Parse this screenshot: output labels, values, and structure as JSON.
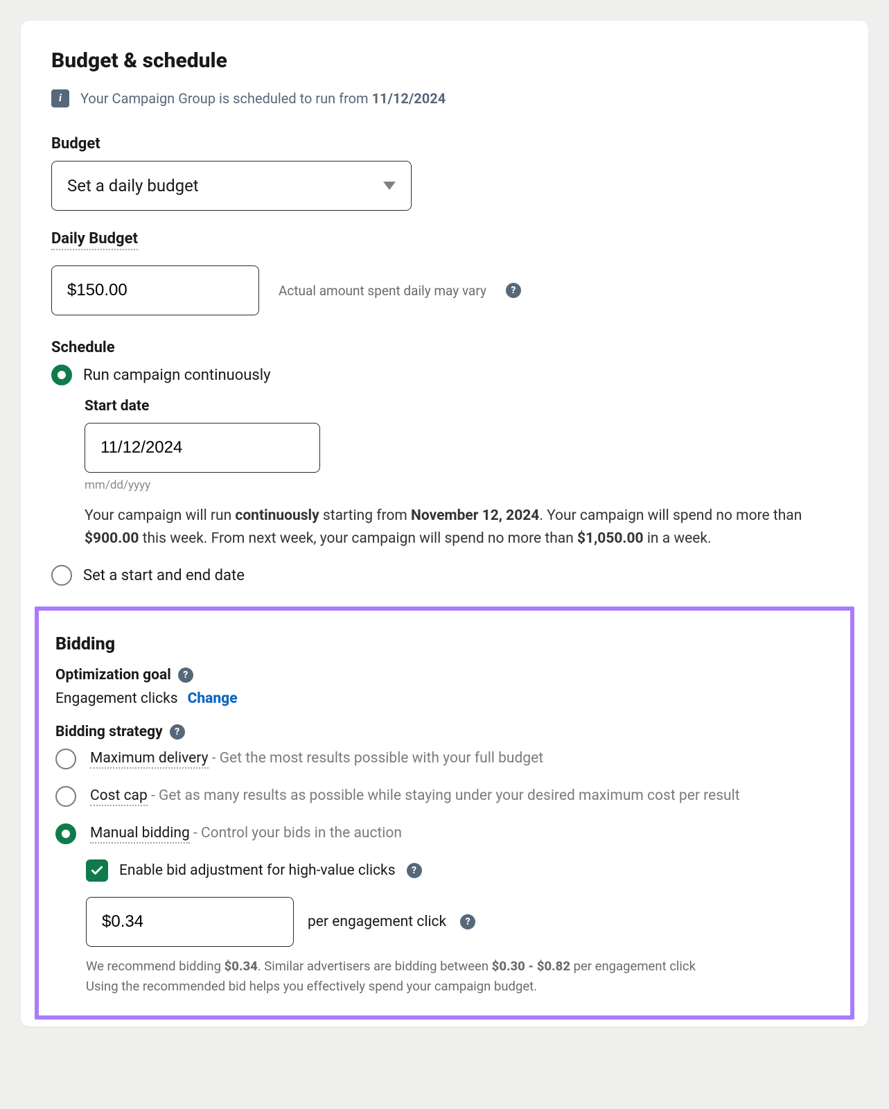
{
  "header": {
    "title": "Budget & schedule",
    "info_prefix": "Your Campaign Group is scheduled to run from ",
    "info_date": "11/12/2024"
  },
  "budget": {
    "section_label": "Budget",
    "select_value": "Set a daily budget",
    "daily_label": "Daily Budget",
    "daily_value": "$150.00",
    "hint": "Actual amount spent daily may vary"
  },
  "schedule": {
    "section_label": "Schedule",
    "option_continuous": "Run campaign continuously",
    "start_date_label": "Start date",
    "start_date_value": "11/12/2024",
    "start_date_format": "mm/dd/yyyy",
    "summary_parts": {
      "p1": "Your campaign will run ",
      "b1": "continuously",
      "p2": " starting from ",
      "b2": "November 12, 2024",
      "p3": ". Your campaign will spend no more than ",
      "b3": "$900.00",
      "p4": " this week. From next week, your campaign will spend no more than ",
      "b4": "$1,050.00",
      "p5": " in a week."
    },
    "option_range": "Set a start and end date"
  },
  "bidding": {
    "section_label": "Bidding",
    "opt_goal_label": "Optimization goal",
    "opt_goal_value": "Engagement clicks",
    "change_link": "Change",
    "strategy_label": "Bidding strategy",
    "options": [
      {
        "name": "Maximum delivery",
        "desc": "Get the most results possible with your full budget",
        "selected": false
      },
      {
        "name": "Cost cap",
        "desc": "Get as many results as possible while staying under your desired maximum cost per result",
        "selected": false
      },
      {
        "name": "Manual bidding",
        "desc": "Control your bids in the auction",
        "selected": true
      }
    ],
    "enable_adjust_label": "Enable bid adjustment for high-value clicks",
    "bid_value": "$0.34",
    "bid_unit": "per engagement click",
    "recommend": {
      "p1": "We recommend bidding ",
      "b1": "$0.34",
      "p2": ". Similar advertisers are bidding between ",
      "b2": "$0.30 - $0.82",
      "p3": " per engagement click",
      "line2": "Using the recommended bid helps you effectively spend your campaign budget."
    }
  }
}
